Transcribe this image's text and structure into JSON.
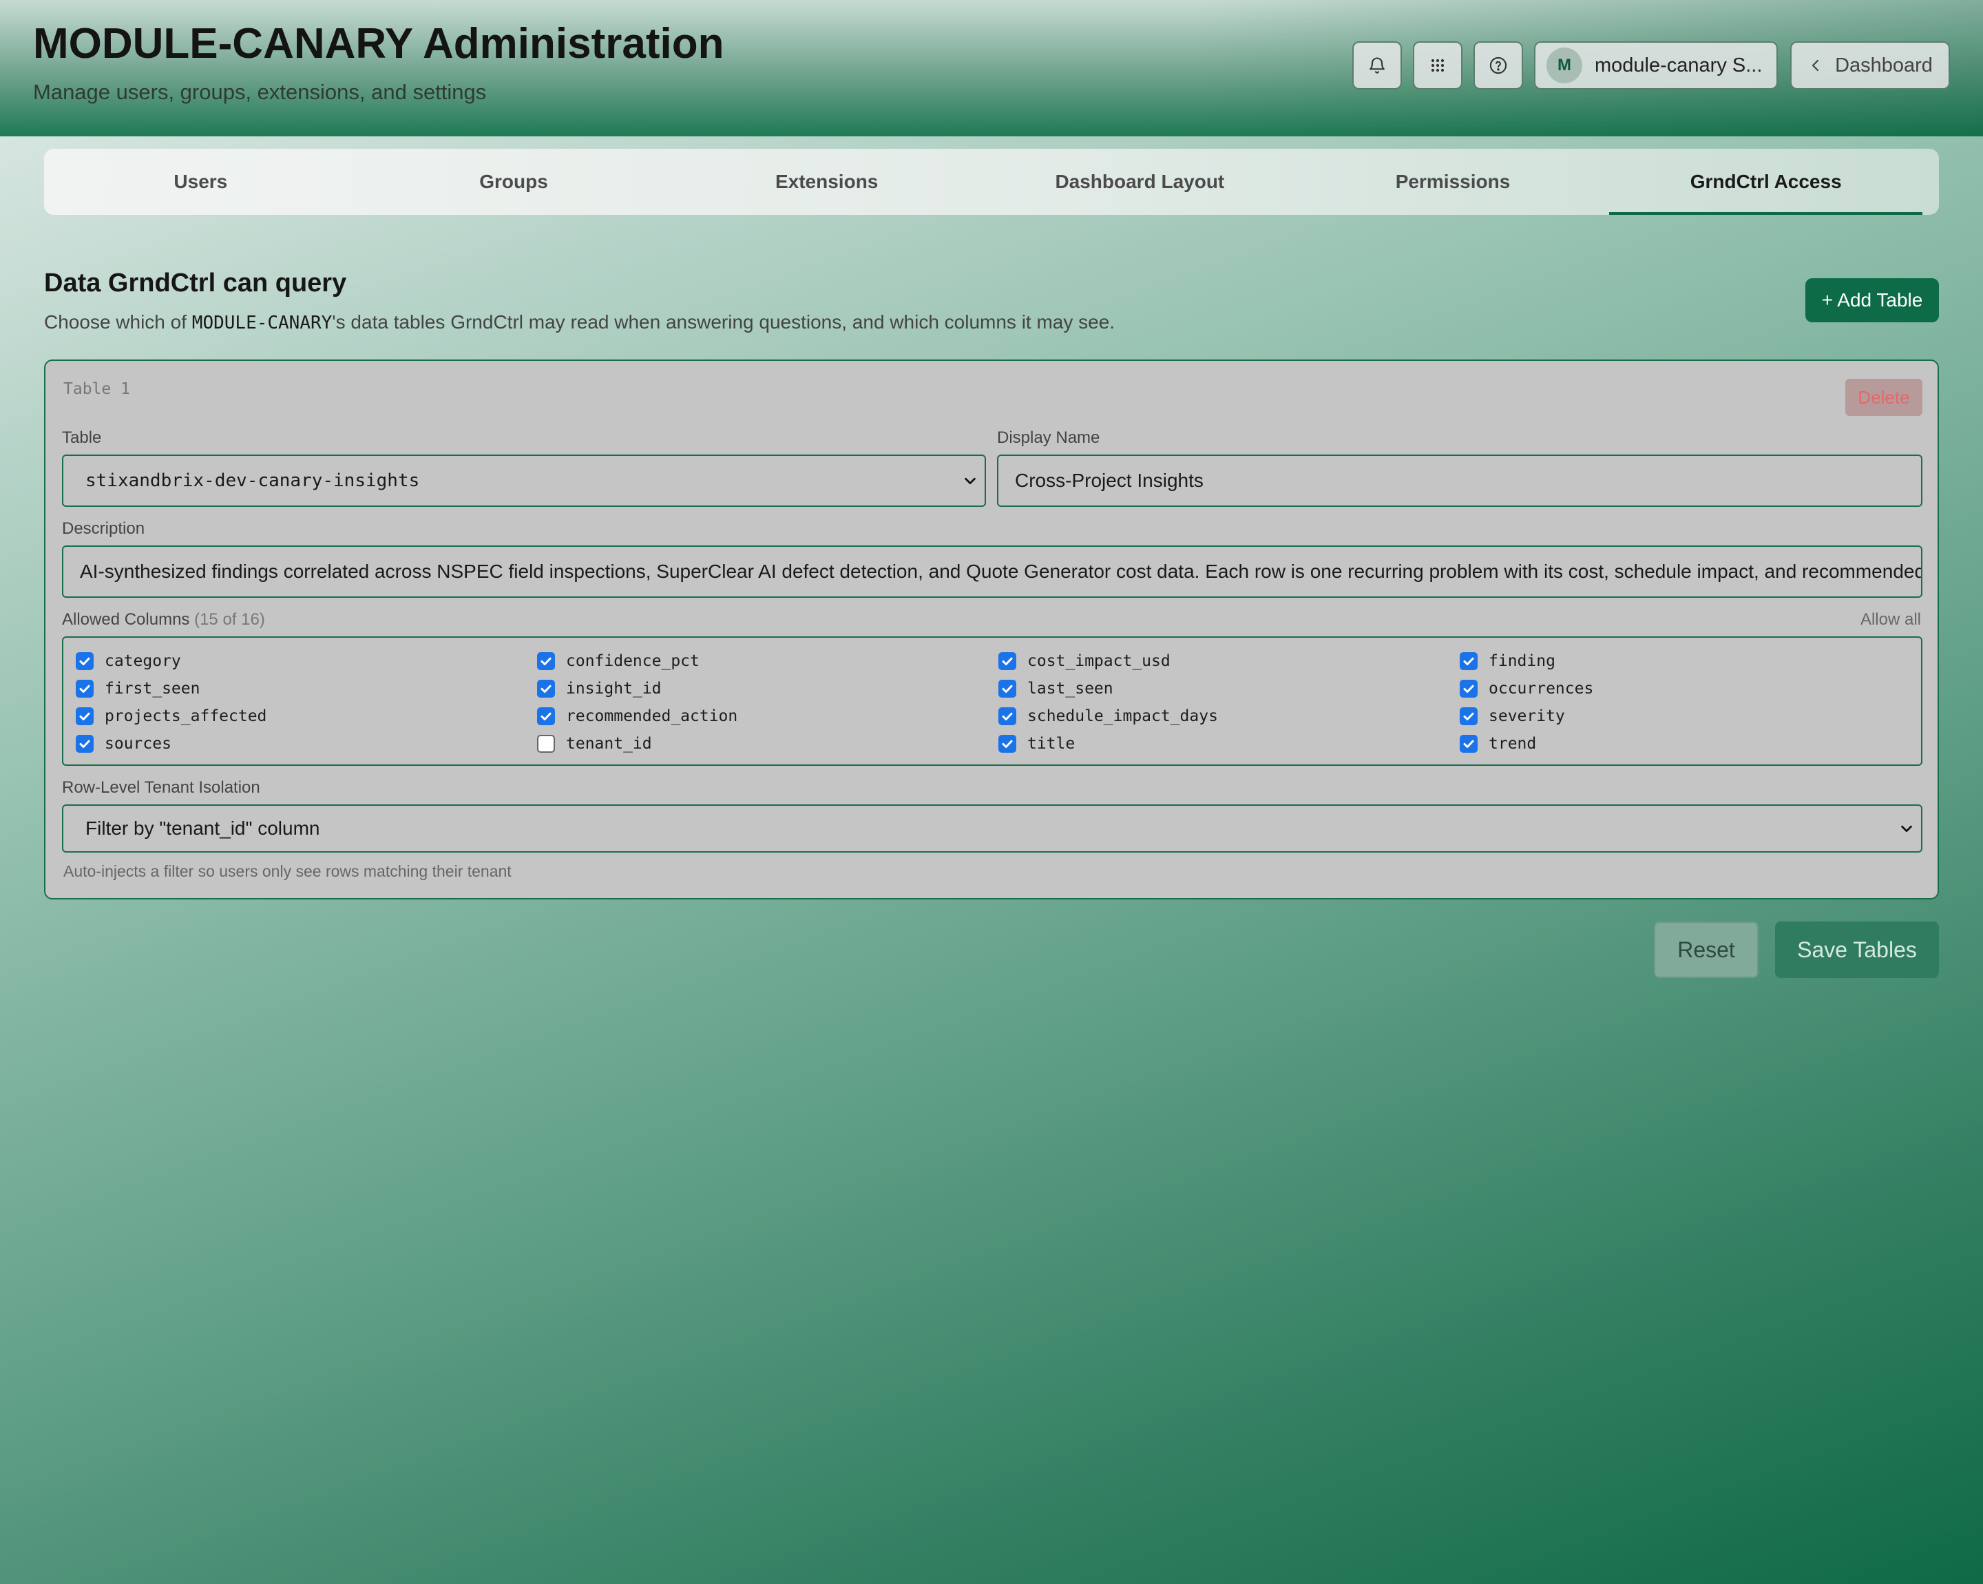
{
  "header": {
    "title": "MODULE-CANARY Administration",
    "subtitle": "Manage users, groups, extensions, and settings",
    "user_initial": "M",
    "user_name": "module-canary S...",
    "dashboard_label": "Dashboard"
  },
  "tabs": [
    {
      "label": "Users"
    },
    {
      "label": "Groups"
    },
    {
      "label": "Extensions"
    },
    {
      "label": "Dashboard Layout"
    },
    {
      "label": "Permissions"
    },
    {
      "label": "GrndCtrl Access",
      "active": true
    }
  ],
  "section": {
    "title": "Data GrndCtrl can query",
    "desc_prefix": "Choose which of ",
    "desc_code": "MODULE-CANARY",
    "desc_suffix": "'s data tables GrndCtrl may read when answering questions, and which columns it may see.",
    "add_button": "+ Add Table"
  },
  "table_card": {
    "label": "Table 1",
    "delete_label": "Delete",
    "table_label": "Table",
    "table_value": "stixandbrix-dev-canary-insights",
    "display_name_label": "Display Name",
    "display_name_value": "Cross-Project Insights",
    "description_label": "Description",
    "description_value": "AI-synthesized findings correlated across NSPEC field inspections, SuperClear AI defect detection, and Quote Generator cost data. Each row is one recurring problem with its cost, schedule impact, and recommended action.",
    "allowed_columns_label": "Allowed Columns",
    "allowed_columns_count": "(15 of 16)",
    "allow_all": "Allow all",
    "columns": [
      {
        "name": "category",
        "checked": true
      },
      {
        "name": "confidence_pct",
        "checked": true
      },
      {
        "name": "cost_impact_usd",
        "checked": true
      },
      {
        "name": "finding",
        "checked": true
      },
      {
        "name": "first_seen",
        "checked": true
      },
      {
        "name": "insight_id",
        "checked": true
      },
      {
        "name": "last_seen",
        "checked": true
      },
      {
        "name": "occurrences",
        "checked": true
      },
      {
        "name": "projects_affected",
        "checked": true
      },
      {
        "name": "recommended_action",
        "checked": true
      },
      {
        "name": "schedule_impact_days",
        "checked": true
      },
      {
        "name": "severity",
        "checked": true
      },
      {
        "name": "sources",
        "checked": true
      },
      {
        "name": "tenant_id",
        "checked": false
      },
      {
        "name": "title",
        "checked": true
      },
      {
        "name": "trend",
        "checked": true
      }
    ],
    "isolation_label": "Row-Level Tenant Isolation",
    "isolation_value": "Filter by \"tenant_id\" column",
    "isolation_hint": "Auto-injects a filter so users only see rows matching their tenant"
  },
  "footer": {
    "reset_label": "Reset",
    "save_label": "Save Tables"
  },
  "colors": {
    "accent": "#0d6b47",
    "checkbox": "#1a73e8",
    "delete_text": "#e06a6a"
  }
}
